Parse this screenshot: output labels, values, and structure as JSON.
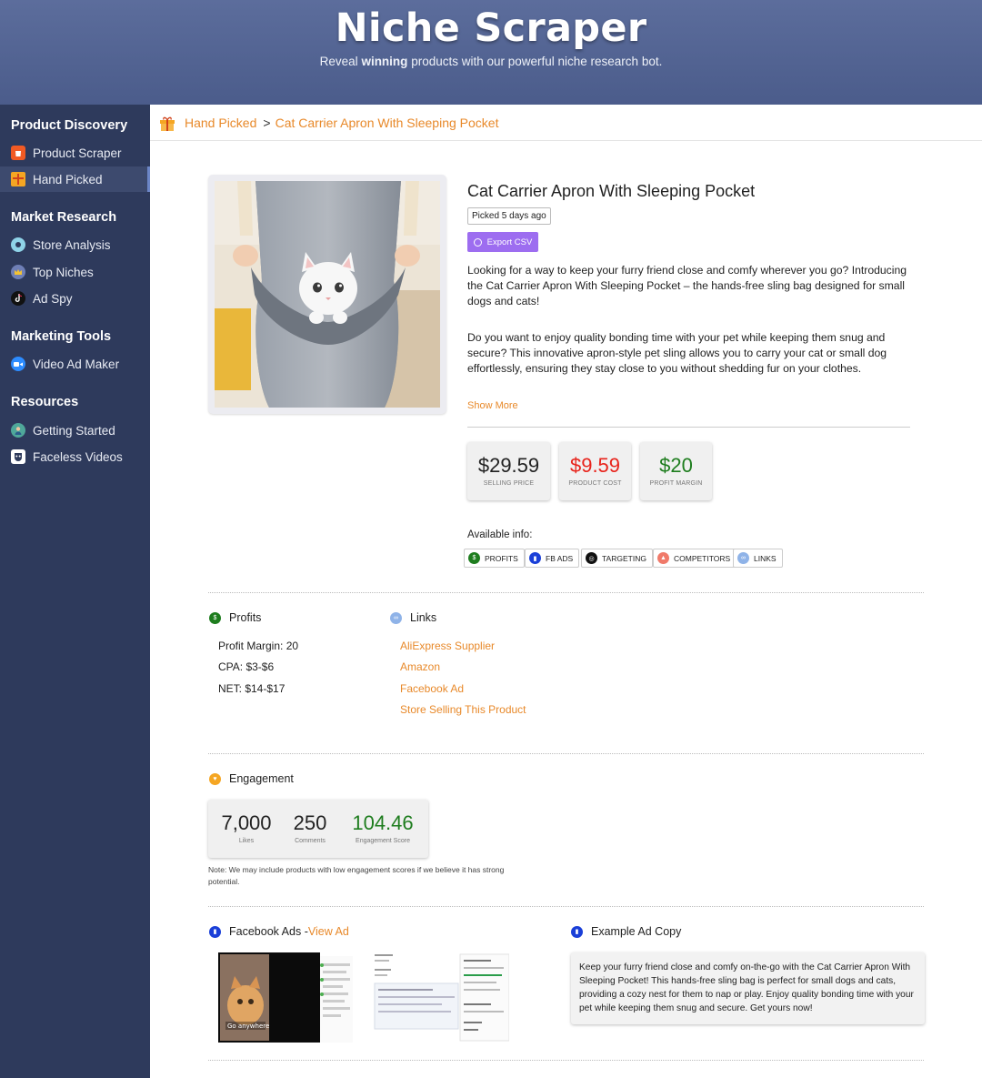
{
  "header": {
    "title": "Niche Scraper",
    "subtitle_pre": "Reveal ",
    "subtitle_bold": "winning",
    "subtitle_post": " products with our powerful niche research bot."
  },
  "sidebar": {
    "sections": [
      {
        "title": "Product Discovery",
        "items": [
          {
            "label": "Product Scraper",
            "icon": "shopping-bag-icon",
            "active": false
          },
          {
            "label": "Hand Picked",
            "icon": "gift-icon",
            "active": true
          }
        ]
      },
      {
        "title": "Market Research",
        "items": [
          {
            "label": "Store Analysis",
            "icon": "eye-icon"
          },
          {
            "label": "Top Niches",
            "icon": "crown-icon"
          },
          {
            "label": "Ad Spy",
            "icon": "tiktok-icon"
          }
        ]
      },
      {
        "title": "Marketing Tools",
        "items": [
          {
            "label": "Video Ad Maker",
            "icon": "video-camera-icon"
          }
        ]
      },
      {
        "title": "Resources",
        "items": [
          {
            "label": "Getting Started",
            "icon": "person-icon"
          },
          {
            "label": "Faceless Videos",
            "icon": "mask-icon"
          }
        ]
      }
    ]
  },
  "breadcrumb": {
    "icon": "gift-icon",
    "parent": "Hand Picked",
    "separator": ">",
    "current": "Cat Carrier Apron With Sleeping Pocket"
  },
  "product": {
    "title": "Cat Carrier Apron With Sleeping Pocket",
    "picked": "Picked 5 days ago",
    "export_label": "Export CSV",
    "desc1": "Looking for a way to keep your furry friend close and comfy wherever you go? Introducing the Cat Carrier Apron With Sleeping Pocket – the hands-free sling bag designed for small dogs and cats!",
    "desc2": "Do you want to enjoy quality bonding time with your pet while keeping them snug and secure? This innovative apron-style pet sling allows you to carry your cat or small dog effortlessly, ensuring they stay close to you without shedding fur on your clothes.",
    "show_more": "Show More"
  },
  "prices": [
    {
      "value": "$29.59",
      "label": "SELLING PRICE",
      "color": "#222222"
    },
    {
      "value": "$9.59",
      "label": "PRODUCT COST",
      "color": "#e8231b"
    },
    {
      "value": "$20",
      "label": "PROFIT MARGIN",
      "color": "#1e7d1e"
    }
  ],
  "available": {
    "label": "Available info:",
    "chips": [
      {
        "label": "PROFITS",
        "icon": "dollar-icon",
        "color": "#1e7d1e"
      },
      {
        "label": "FB ADS",
        "icon": "bar-chart-icon",
        "color": "#1a3fd8"
      },
      {
        "label": "TARGETING",
        "icon": "target-icon",
        "color": "#111111"
      },
      {
        "label": "COMPETITORS",
        "icon": "flame-icon",
        "color": "#f07a6a"
      },
      {
        "label": "LINKS",
        "icon": "link-icon",
        "color": "#8fb3e8"
      }
    ]
  },
  "profits": {
    "title": "Profits",
    "lines": [
      "Profit Margin: 20",
      "CPA: $3-$6",
      "NET: $14-$17"
    ]
  },
  "links": {
    "title": "Links",
    "items": [
      "AliExpress Supplier",
      "Amazon",
      "Facebook Ad",
      "Store Selling This Product"
    ]
  },
  "engagement": {
    "title": "Engagement",
    "likes": "7,000",
    "likes_label": "Likes",
    "comments": "250",
    "comments_label": "Comments",
    "score": "104.46",
    "score_label": "Engagement Score",
    "note": "Note: We may include products with low engagement scores if we believe it has strong potential."
  },
  "facebook_ads": {
    "title": "Facebook Ads -",
    "view_link": "View Ad",
    "thumb_caption": "Go anywhere"
  },
  "ad_copy": {
    "title": "Example Ad Copy",
    "text": "Keep your furry friend close and comfy on-the-go with the Cat Carrier Apron With Sleeping Pocket! This hands-free sling bag is perfect for small dogs and cats, providing a cozy nest for them to nap or play. Enjoy quality bonding time with your pet while keeping them snug and secure. Get yours now!"
  }
}
